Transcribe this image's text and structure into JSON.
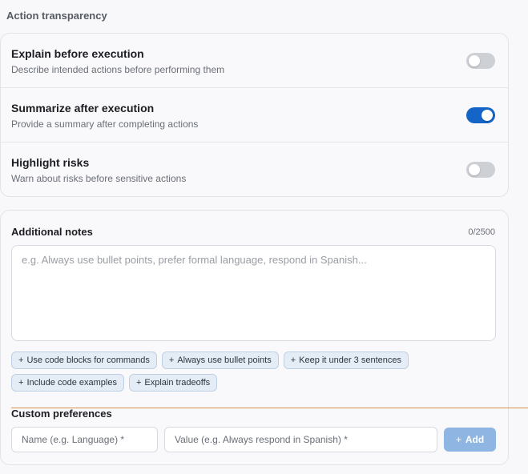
{
  "section_title": "Action transparency",
  "toggles": [
    {
      "title": "Explain before execution",
      "description": "Describe intended actions before performing them",
      "on": false
    },
    {
      "title": "Summarize after execution",
      "description": "Provide a summary after completing actions",
      "on": true
    },
    {
      "title": "Highlight risks",
      "description": "Warn about risks before sensitive actions",
      "on": false
    }
  ],
  "notes": {
    "label": "Additional notes",
    "char_count": "0/2500",
    "placeholder": "e.g. Always use bullet points, prefer formal language, respond in Spanish..."
  },
  "chips": [
    "Use code blocks for commands",
    "Always use bullet points",
    "Keep it under 3 sentences",
    "Include code examples",
    "Explain tradeoffs"
  ],
  "custom": {
    "label": "Custom preferences",
    "name_placeholder": "Name (e.g. Language) *",
    "value_placeholder": "Value (e.g. Always respond in Spanish) *",
    "add_label": "Add"
  },
  "colors": {
    "accent": "#1565c8",
    "add_button": "#8fb6e2",
    "chip_bg": "#e4ecf6"
  }
}
